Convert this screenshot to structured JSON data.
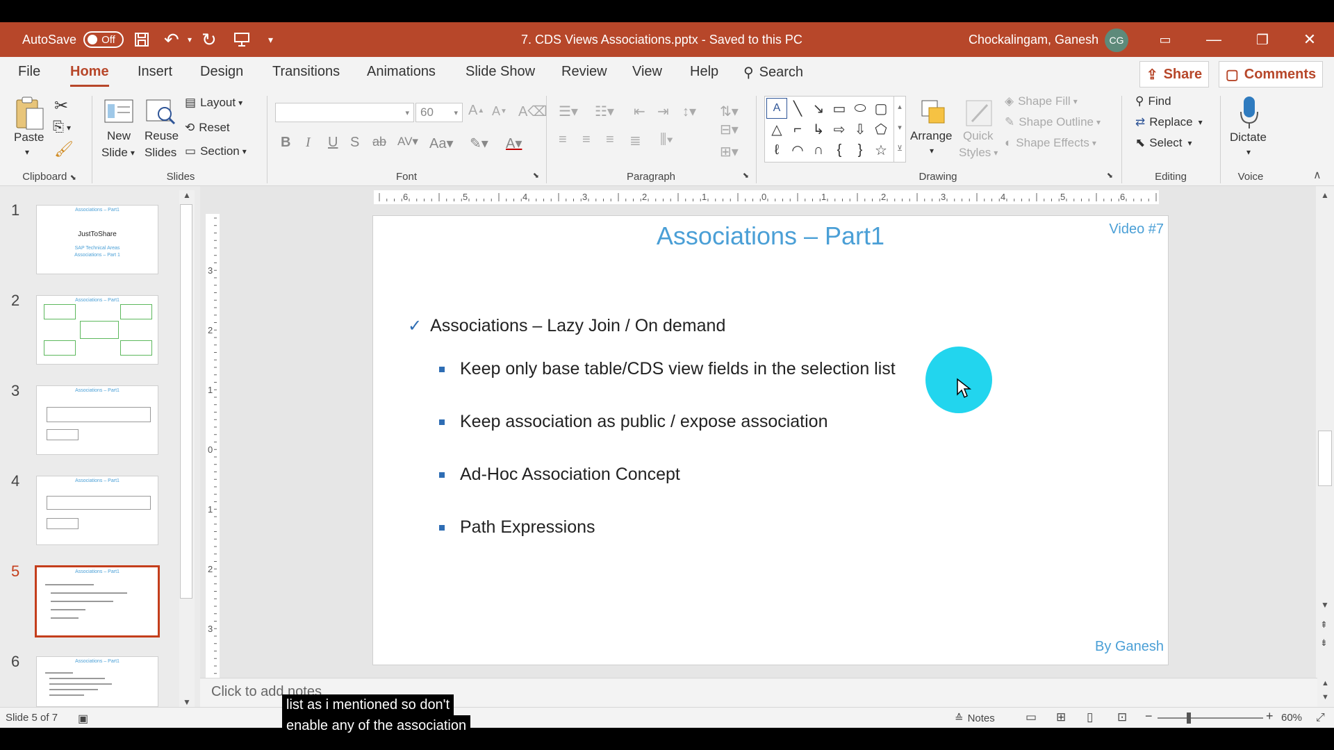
{
  "app": {
    "document_title": "7. CDS Views Associations.pptx  -  Saved to this PC",
    "autosave_label": "AutoSave",
    "autosave_state": "Off",
    "user_name": "Chockalingam, Ganesh",
    "user_initials": "CG"
  },
  "menu": {
    "tabs": [
      "File",
      "Home",
      "Insert",
      "Design",
      "Transitions",
      "Animations",
      "Slide Show",
      "Review",
      "View",
      "Help"
    ],
    "active_tab": "Home",
    "search_label": "Search",
    "share_label": "Share",
    "comments_label": "Comments"
  },
  "ribbon": {
    "clipboard": {
      "paste": "Paste",
      "label": "Clipboard"
    },
    "slides": {
      "new_slide_1": "New",
      "new_slide_2": "Slide",
      "reuse_1": "Reuse",
      "reuse_2": "Slides",
      "layout": "Layout",
      "reset": "Reset",
      "section": "Section",
      "label": "Slides"
    },
    "font": {
      "size": "60",
      "label": "Font"
    },
    "paragraph": {
      "label": "Paragraph"
    },
    "drawing": {
      "arrange": "Arrange",
      "quick_styles_1": "Quick",
      "quick_styles_2": "Styles",
      "shape_fill": "Shape Fill",
      "shape_outline": "Shape Outline",
      "shape_effects": "Shape Effects",
      "label": "Drawing"
    },
    "editing": {
      "find": "Find",
      "replace": "Replace",
      "select": "Select",
      "label": "Editing"
    },
    "voice": {
      "dictate": "Dictate",
      "label": "Voice"
    }
  },
  "ruler": {
    "h_ticks": [
      "6",
      "5",
      "4",
      "3",
      "2",
      "1",
      "0",
      "1",
      "2",
      "3",
      "4",
      "5",
      "6"
    ],
    "v_ticks": [
      "3",
      "2",
      "1",
      "0",
      "1",
      "2",
      "3"
    ]
  },
  "thumbnails": {
    "numbers": [
      "1",
      "2",
      "3",
      "4",
      "5",
      "6"
    ],
    "active": "5",
    "slide1_title": "JustToShare",
    "slide1_sub1": "SAP Technical Areas",
    "slide1_sub2": "Associations – Part 1",
    "slide_title": "Associations – Part1"
  },
  "slide": {
    "title": "Associations – Part1",
    "corner": "Video #7",
    "footer": "By Ganesh",
    "level1": "Associations – Lazy Join / On demand",
    "bullets": [
      "Keep only base table/CDS view fields in the selection list",
      "Keep association as public / expose association",
      "Ad-Hoc Association Concept",
      "Path Expressions"
    ]
  },
  "notes": {
    "placeholder": "Click to add notes"
  },
  "status": {
    "slide_counter": "Slide 5 of 7",
    "notes_label": "Notes",
    "zoom": "60%"
  },
  "caption": {
    "line1": "list as i mentioned so don't",
    "line2": "enable any of the association"
  },
  "colors": {
    "accent": "#b7472a",
    "slide_title": "#4a9fd6",
    "bullet": "#2e6db4",
    "cursor_halo": "#22d5ee"
  }
}
